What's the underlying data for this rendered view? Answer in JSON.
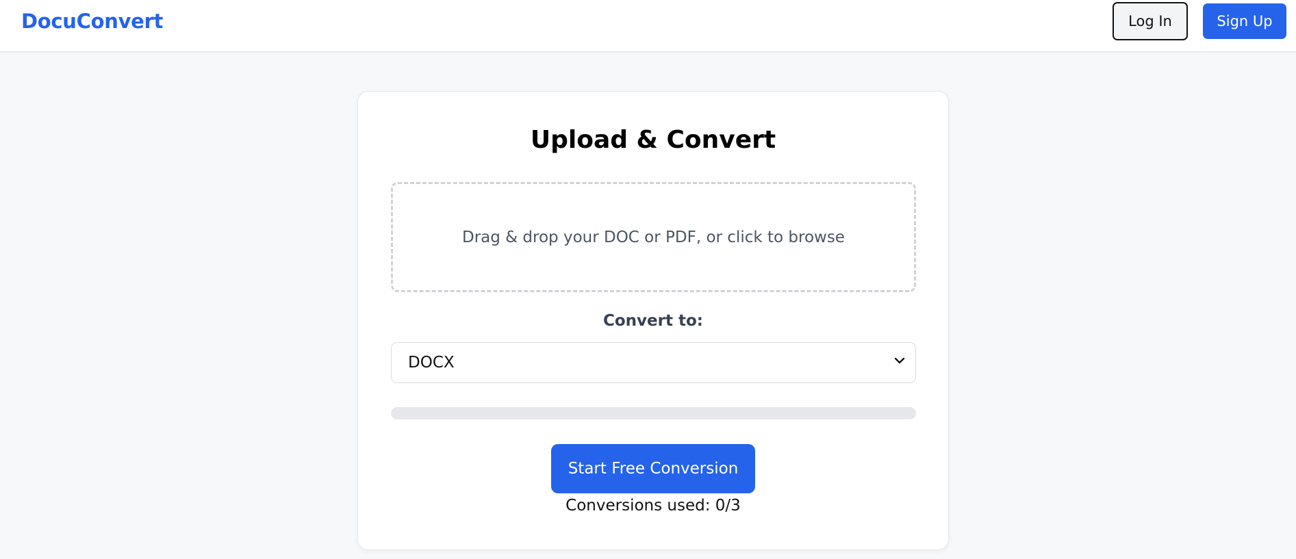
{
  "header": {
    "brand": "DocuConvert",
    "login_label": "Log In",
    "signup_label": "Sign Up"
  },
  "upload": {
    "title": "Upload & Convert",
    "dropzone_text": "Drag & drop your DOC or PDF, or click to browse",
    "convert_label": "Convert to:",
    "selected_format": "DOCX",
    "progress_fraction": 0,
    "start_label": "Start Free Conversion",
    "usage_text": "Conversions used: 0/3"
  },
  "colors": {
    "accent": "#2563eb",
    "page_background": "#f7f8fa",
    "progress_track": "#e5e7eb"
  },
  "icons": {
    "select_arrow": "chevron-down-icon"
  }
}
